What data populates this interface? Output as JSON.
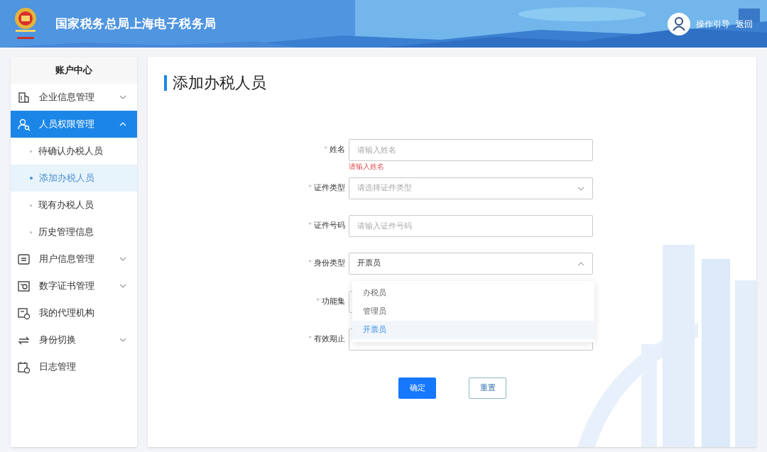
{
  "header": {
    "title": "国家税务总局上海电子税务局",
    "links": [
      "操作引导",
      "返回"
    ]
  },
  "sidebar": {
    "title": "账户中心",
    "items": [
      {
        "label": "企业信息管理",
        "kind": "group",
        "selected": false,
        "expanded": false
      },
      {
        "label": "人员权限管理",
        "kind": "group",
        "selected": true,
        "expanded": true,
        "children": [
          {
            "label": "待确认办税人员",
            "selected": false
          },
          {
            "label": "添加办税人员",
            "selected": true
          },
          {
            "label": "现有办税人员",
            "selected": false
          },
          {
            "label": "历史管理信息",
            "selected": false
          }
        ]
      },
      {
        "label": "用户信息管理",
        "kind": "group",
        "selected": false,
        "expanded": false
      },
      {
        "label": "数字证书管理",
        "kind": "group",
        "selected": false,
        "expanded": false
      },
      {
        "label": "我的代理机构",
        "kind": "link",
        "selected": false
      },
      {
        "label": "身份切换",
        "kind": "group",
        "selected": false,
        "expanded": false
      },
      {
        "label": "日志管理",
        "kind": "link",
        "selected": false
      }
    ]
  },
  "page_title": "添加办税人员",
  "form": {
    "fields": [
      {
        "label": "姓名",
        "mark": "*",
        "kind": "input",
        "placeholder": "请输入姓名",
        "error": "请输入姓名"
      },
      {
        "label": "证件类型",
        "mark": "*",
        "kind": "select",
        "placeholder": "请选择证件类型",
        "expanded": false
      },
      {
        "label": "证件号码",
        "mark": "*",
        "kind": "input",
        "placeholder": "请输入证件号码"
      },
      {
        "label": "身份类型",
        "mark": "*",
        "kind": "select",
        "value": "开票员",
        "expanded": true,
        "options": [
          {
            "label": "办税员",
            "selected": false
          },
          {
            "label": "管理员",
            "selected": false
          },
          {
            "label": "开票员",
            "selected": true
          }
        ]
      },
      {
        "label": "功能集",
        "mark": "*",
        "kind": "covered"
      },
      {
        "label": "有效期止",
        "mark": "*",
        "kind": "covered"
      }
    ],
    "buttons": [
      {
        "label": "确定",
        "kind": "primary"
      },
      {
        "label": "重置",
        "kind": "secondary"
      }
    ]
  }
}
